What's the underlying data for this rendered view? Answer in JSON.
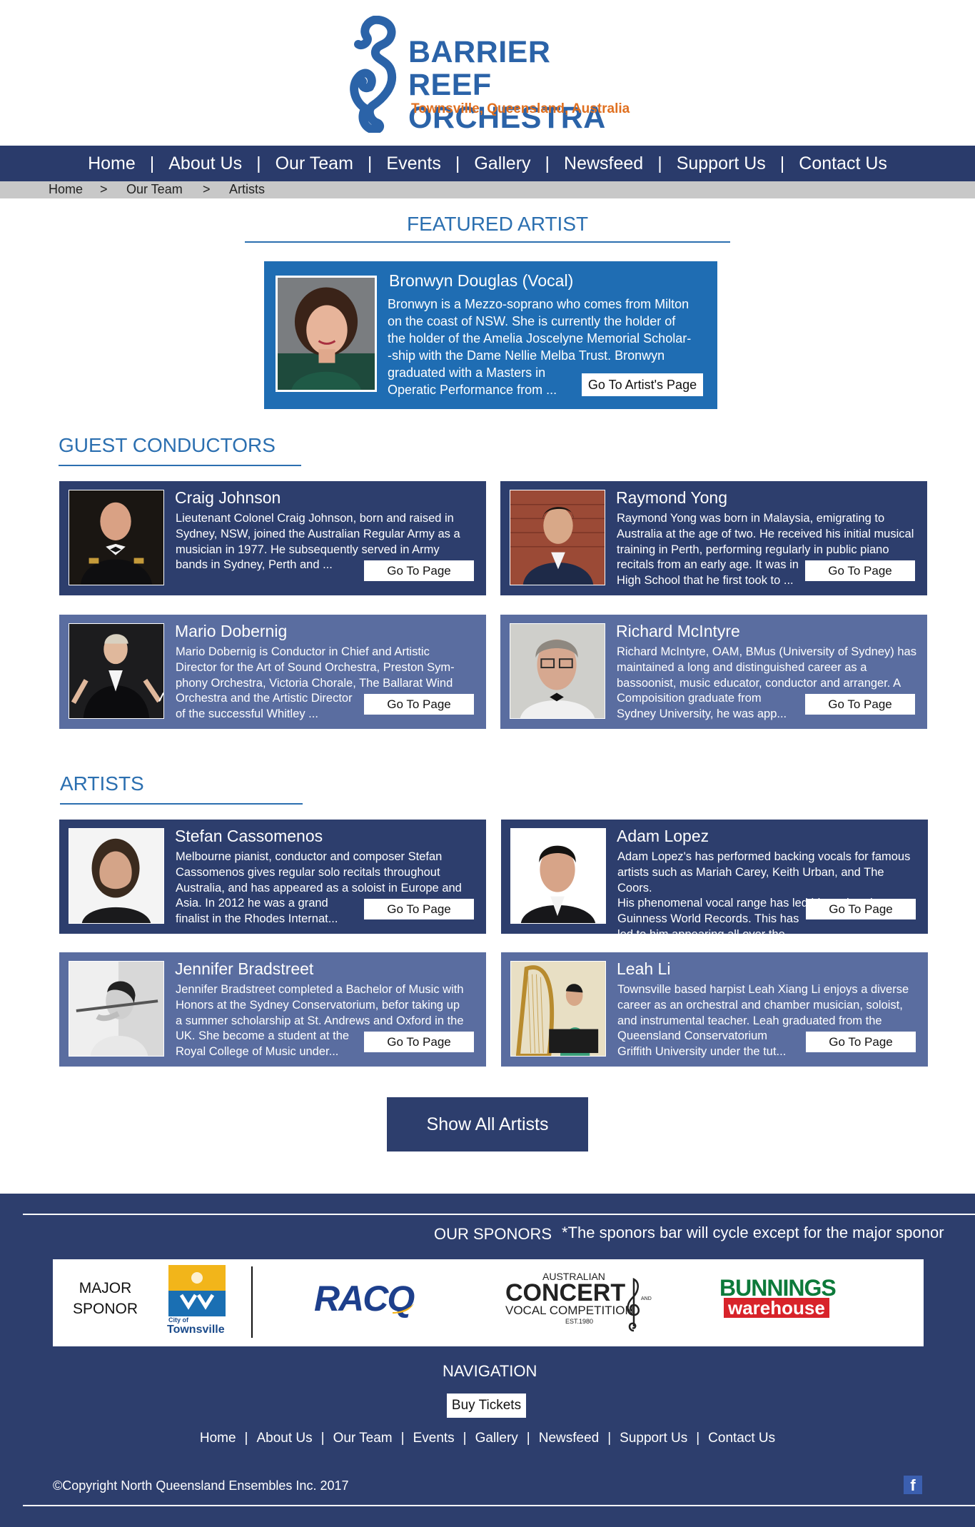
{
  "logo": {
    "line1": "BARRIER REEF",
    "line2": "ORCHESTRA",
    "sub": "Townsville, Queensland, Australia"
  },
  "nav": [
    "Home",
    "About Us",
    "Our Team",
    "Events",
    "Gallery",
    "Newsfeed",
    "Support Us",
    "Contact Us"
  ],
  "breadcrumb": [
    "Home",
    ">",
    "Our Team",
    ">",
    "Artists"
  ],
  "featured": {
    "heading": "FEATURED ARTIST",
    "name": "Bronwyn Douglas (Vocal)",
    "text": [
      "Bronwyn is a Mezzo-soprano who comes from Milton",
      " on the coast of NSW. She is currently the holder of",
      " the holder of the Amelia Joscelyne Memorial Scholar-",
      " -ship with the Dame Nellie Melba Trust. Bronwyn",
      " graduated with a Masters in",
      " Operatic Performance from ..."
    ],
    "button": "Go To Artist's Page"
  },
  "conductors": {
    "heading": "GUEST CONDUCTORS",
    "cards": [
      {
        "name": "Craig Johnson",
        "text": [
          "Lieutenant Colonel Craig Johnson, born and raised in",
          "Sydney, NSW, joined the Australian Regular Army as a",
          "musician in 1977. He subsequently served in Army",
          "bands in Sydney, Perth and ..."
        ],
        "button": "Go To Page"
      },
      {
        "name": "Raymond Yong",
        "text": [
          "Raymond Yong was born in Malaysia, emigrating to",
          " Australia at the age of two. He received his initial musical",
          " training in Perth, performing regularly in public piano",
          " recitals from an early age. It was in",
          " High School that he first took to ..."
        ],
        "button": "Go To Page"
      },
      {
        "name": "Mario Dobernig",
        "text": [
          "Mario Dobernig is Conductor in Chief and Artistic",
          " Director for the Art of Sound Orchestra, Preston Sym-",
          " phony Orchestra, Victoria Chorale, The Ballarat Wind",
          " Orchestra and the Artistic Director",
          " of the successful Whitley ..."
        ],
        "button": "Go To Page"
      },
      {
        "name": "Richard McIntyre",
        "text": [
          "Richard McIntyre, OAM, BMus (University of Sydney) has",
          " maintained a long and distinguished career as a",
          " bassoonist, music educator, conductor and arranger. A",
          " Compoisition graduate from",
          " Sydney University, he was app..."
        ],
        "button": "Go To Page"
      }
    ]
  },
  "artists": {
    "heading": "ARTISTS",
    "cards": [
      {
        "name": "Stefan Cassomenos",
        "text": [
          "Melbourne pianist, conductor and composer Stefan",
          " Cassomenos gives regular solo recitals throughout",
          " Australia, and has appeared as a soloist in Europe and",
          " Asia. In 2012 he was a grand",
          " finalist in the Rhodes Internat..."
        ],
        "button": "Go To Page"
      },
      {
        "name": "Adam Lopez",
        "text": [
          "Adam Lopez's has performed backing vocals for famous",
          " artists such as Mariah Carey, Keith Urban, and The Coors.",
          " His phenomenal vocal range has led him to break two",
          " Guinness World Records. This has",
          " led to him appearing all over the..."
        ],
        "button": "Go To Page"
      },
      {
        "name": "Jennifer Bradstreet",
        "text": [
          "Jennifer Bradstreet completed a Bachelor of Music with",
          " Honors at the Sydney Conservatorium, befor taking up",
          " a summer scholarship at St. Andrews and Oxford in the",
          " UK. She become a student at the",
          " Royal College of Music under..."
        ],
        "button": "Go To Page"
      },
      {
        "name": "Leah Li",
        "text": [
          "Townsville based harpist Leah Xiang Li enjoys a diverse",
          " career as an orchestral and chamber musician, soloist,",
          " and instrumental teacher. Leah graduated from the",
          " Queensland Conservatorium",
          " Griffith University under the tut..."
        ],
        "button": "Go To Page"
      }
    ]
  },
  "show_all": "Show All Artists",
  "footer": {
    "sponsors_heading": "OUR SPONORS",
    "sponsors_note": "*The sponors bar will cycle except for the major sponor",
    "major_label": [
      "MAJOR",
      "SPONOR"
    ],
    "sponsors": {
      "townsville_small": "City of",
      "townsville": "Townsville",
      "racq": "RACQ",
      "concert_line1": "AUSTRALIAN",
      "concert_line2": "CONCERT",
      "concert_line3": "VOCAL COMPETITION",
      "concert_line4": "EST.1980",
      "concert_and": "AND",
      "bunnings_line1": "BUNNINGS",
      "bunnings_line2": "warehouse"
    },
    "nav_heading": "NAVIGATION",
    "buy_tickets": "Buy Tickets",
    "nav": [
      "Home",
      "About Us",
      "Our Team",
      "Events",
      "Gallery",
      "Newsfeed",
      "Support Us",
      "Contact Us"
    ],
    "copyright": "©Copyright North Queensland Ensembles Inc. 2017",
    "facebook_glyph": "f"
  },
  "colors": {
    "navy": "#2a3b6b",
    "card_dark": "#2d3e6d",
    "card_light": "#5a6da0",
    "featured_blue": "#1f6db3",
    "heading_blue": "#2b6fb0",
    "logo_orange": "#e07020"
  }
}
